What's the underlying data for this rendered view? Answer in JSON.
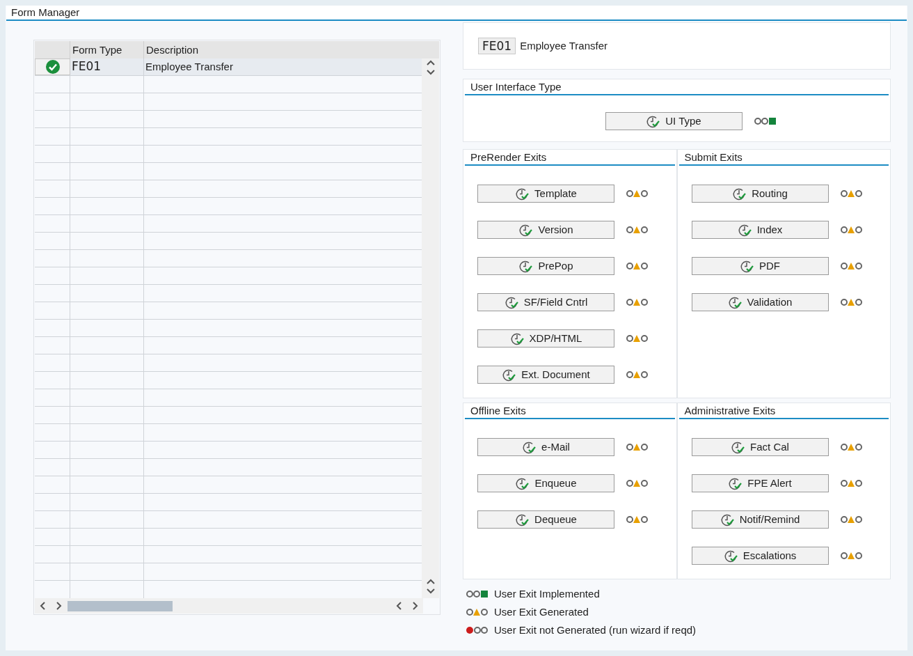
{
  "title": "Form Manager",
  "table": {
    "columns": [
      "Form Type",
      "Description"
    ],
    "rows": [
      {
        "kind": "valid",
        "selected": true,
        "form_type": "FE01",
        "description": "Employee Transfer"
      }
    ]
  },
  "header": {
    "code": "FE01",
    "description": "Employee Transfer"
  },
  "ui_section": {
    "title": "User Interface Type",
    "buttons": [
      {
        "label": "UI Type",
        "kind": "implemented"
      }
    ]
  },
  "sections": [
    {
      "title": "PreRender Exits",
      "exits": [
        {
          "label": "Template",
          "kind": "generated"
        },
        {
          "label": "Version",
          "kind": "generated"
        },
        {
          "label": "PrePop",
          "kind": "generated"
        },
        {
          "label": "SF/Field Cntrl",
          "kind": "generated"
        },
        {
          "label": "XDP/HTML",
          "kind": "generated"
        },
        {
          "label": "Ext. Document",
          "kind": "generated"
        }
      ]
    },
    {
      "title": "Submit Exits",
      "exits": [
        {
          "label": "Routing",
          "kind": "generated"
        },
        {
          "label": "Index",
          "kind": "generated"
        },
        {
          "label": "PDF",
          "kind": "generated"
        },
        {
          "label": "Validation",
          "kind": "generated"
        }
      ]
    },
    {
      "title": "Offline Exits",
      "exits": [
        {
          "label": "e-Mail",
          "kind": "generated"
        },
        {
          "label": "Enqueue",
          "kind": "generated"
        },
        {
          "label": "Dequeue",
          "kind": "generated"
        }
      ]
    },
    {
      "title": "Administrative Exits",
      "exits": [
        {
          "label": "Fact Cal",
          "kind": "generated"
        },
        {
          "label": "FPE Alert",
          "kind": "generated"
        },
        {
          "label": "Notif/Remind",
          "kind": "generated"
        },
        {
          "label": "Escalations",
          "kind": "generated"
        }
      ]
    }
  ],
  "legend": [
    {
      "kind": "implemented",
      "label": "User Exit Implemented"
    },
    {
      "kind": "generated",
      "label": "User Exit Generated"
    },
    {
      "kind": "not_generated",
      "label": "User Exit not Generated (run wizard if reqd)"
    }
  ]
}
